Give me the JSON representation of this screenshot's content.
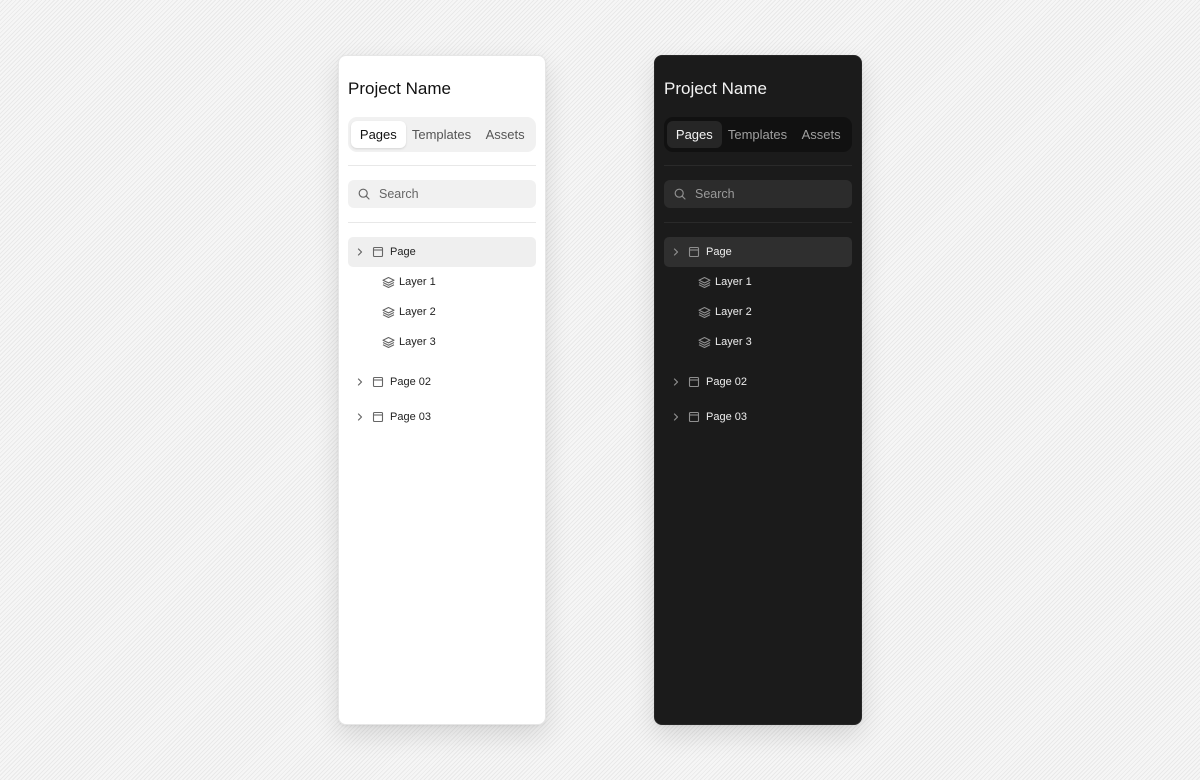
{
  "panels": [
    {
      "theme": "light",
      "project_title": "Project Name",
      "tabs": [
        "Pages",
        "Templates",
        "Assets"
      ],
      "active_tab": "Pages",
      "search": {
        "placeholder": "Search",
        "icon": "search-icon"
      },
      "tree": {
        "page": {
          "label": "Page",
          "icon": "page-icon",
          "selected": true,
          "layers": [
            "Layer 1",
            "Layer 2",
            "Layer 3"
          ]
        },
        "page2": {
          "label": "Page 02",
          "icon": "page-icon"
        },
        "page3": {
          "label": "Page 03",
          "icon": "page-icon"
        }
      }
    },
    {
      "theme": "dark",
      "project_title": "Project Name",
      "tabs": [
        "Pages",
        "Templates",
        "Assets"
      ],
      "active_tab": "Pages",
      "search": {
        "placeholder": "Search",
        "icon": "search-icon"
      },
      "tree": {
        "page": {
          "label": "Page",
          "icon": "page-icon",
          "selected": true,
          "layers": [
            "Layer 1",
            "Layer 2",
            "Layer 3"
          ]
        },
        "page2": {
          "label": "Page 02",
          "icon": "page-icon"
        },
        "page3": {
          "label": "Page 03",
          "icon": "page-icon"
        }
      }
    }
  ],
  "colors": {
    "light_panel_bg": "#ffffff",
    "dark_panel_bg": "#1b1b1b",
    "light_selected_row": "#efefef",
    "dark_selected_row": "#2f2f2f"
  }
}
